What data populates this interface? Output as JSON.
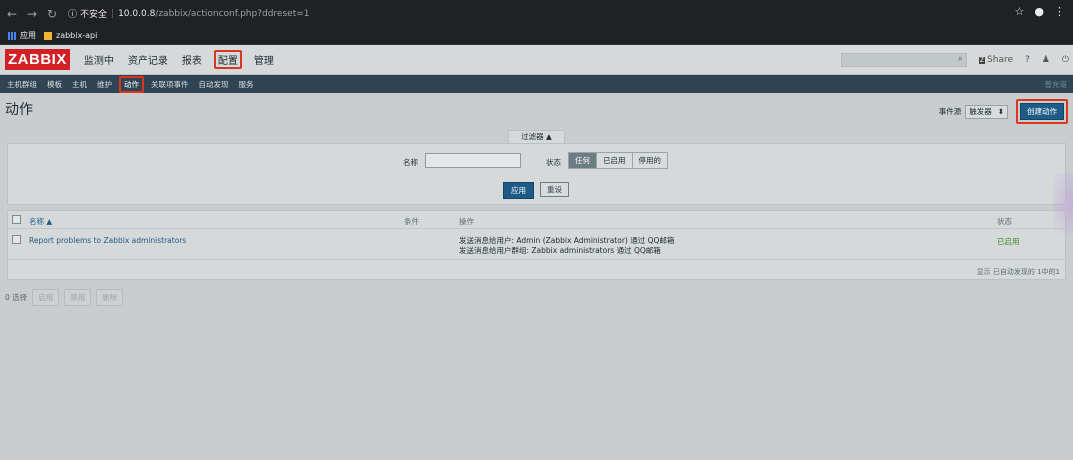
{
  "browser": {
    "security_text": "不安全",
    "url_host": "10.0.0.8",
    "url_path": "/zabbix/actionconf.php?ddreset=1",
    "bookmarks": [
      "应用",
      "zabbix-api"
    ]
  },
  "topnav": {
    "logo": "ZABBIX",
    "menu": [
      "监测中",
      "资产记录",
      "报表",
      "配置",
      "管理"
    ],
    "share": "Share",
    "help": "?"
  },
  "subnav": {
    "items": [
      "主机群组",
      "模板",
      "主机",
      "维护",
      "动作",
      "关联项事件",
      "自动发现",
      "服务"
    ],
    "right": "普充道"
  },
  "page": {
    "title": "动作",
    "event_source_label": "事件源",
    "event_source_value": "触发器",
    "create_button": "创建动作"
  },
  "filter": {
    "tab": "过滤器 ▲",
    "name_label": "名称",
    "status_label": "状态",
    "status_options": [
      "任何",
      "已启用",
      "停用的"
    ],
    "apply": "应用",
    "reset": "重设"
  },
  "table": {
    "headers": {
      "name": "名称 ▲",
      "conditions": "条件",
      "operations": "操作",
      "status": "状态"
    },
    "rows": [
      {
        "name": "Report problems to Zabbix administrators",
        "op1": "发送消息给用户: Admin (Zabbix Administrator) 通过 QQ邮箱",
        "op2": "发送消息给用户群组: Zabbix administrators 通过 QQ邮箱",
        "status": "已启用"
      }
    ],
    "footer": "显示 已自动发现的 1中的1"
  },
  "bottom": {
    "selected": "0 选择",
    "buttons": [
      "启用",
      "禁用",
      "删除"
    ]
  },
  "colors": {
    "accent": "#1e5b87",
    "highlight": "#d9361c",
    "enabled": "#3b8a25"
  }
}
